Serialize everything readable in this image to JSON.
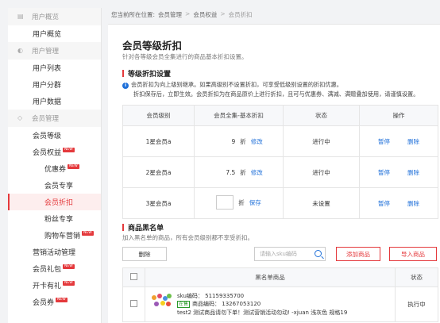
{
  "sidebar": {
    "g1": "用户概览",
    "i1": "用户概览",
    "g2": "用户管理",
    "i2": "用户列表",
    "i3": "用户分群",
    "i4": "用户数据",
    "g3": "会员管理",
    "i5": "会员等级",
    "i6": "会员权益",
    "i7": "优惠券",
    "i8": "会员专享",
    "i9": "会员折扣",
    "i10": "粉丝专享",
    "i11": "购物车营销",
    "i12": "营销活动管理",
    "i13": "会员礼包",
    "i14": "开卡有礼",
    "i15": "会员券",
    "new_badge": "NEW"
  },
  "breadcrumb": {
    "prefix": "您当前所在位置:",
    "b1": "会员管理",
    "b2": "会员权益",
    "b3": "会员折扣",
    "sep": ">"
  },
  "page": {
    "title": "会员等级折扣",
    "desc": "针对各等级会员全集进行的商品基本折扣设置。",
    "section1": "等级折扣设置",
    "note_line1": "会员折扣为向上级别继承。如果高级别不设置折扣，可享受低级别设置的折扣优惠。",
    "note_line2": "折扣保存后，立即生效。会员折扣为在商品原价上进行折扣，且可与优惠券、满减、满赠叠加使用，请谨慎设置。"
  },
  "tier_table": {
    "headers": [
      "会员级别",
      "会员全集-基本折扣",
      "状态",
      "操作"
    ],
    "discount_unit": "折",
    "rows": [
      {
        "level": "1星会员a",
        "discount": "9",
        "action": "修改",
        "status": "进行中",
        "op1": "暂停",
        "op2": "删除"
      },
      {
        "level": "2星会员a",
        "discount": "7.5",
        "action": "修改",
        "status": "进行中",
        "op1": "暂停",
        "op2": "删除"
      },
      {
        "level": "3星会员a",
        "discount": "",
        "action": "保存",
        "status": "未设置",
        "op1": "暂停",
        "op2": "删除"
      }
    ]
  },
  "blacklist": {
    "section": "商品黑名单",
    "desc": "加入黑名单的商品，所有会员级别都不享受折扣。",
    "delete_btn": "删除",
    "search_placeholder": "请输入sku编码",
    "add_btn": "添加商品",
    "import_btn": "导入商品",
    "headers": [
      "黑名单商品",
      "状态"
    ],
    "row": {
      "sku_line": "sku编码： 51159335700",
      "onsale": "在售",
      "code_line": "商品编码： 13267053120",
      "name_line": "test2 测试商品请勿下单！测试营销活动勿动! -xjuan 浅灰色 规格19",
      "status": "执行中"
    }
  },
  "colors": {
    "accent": "#e4393c",
    "link": "#1e6fd9",
    "ok": "#2a9a2a"
  }
}
